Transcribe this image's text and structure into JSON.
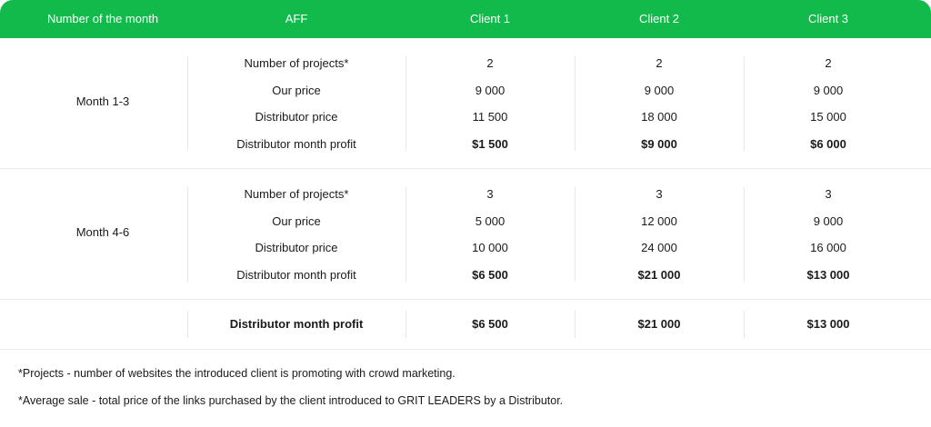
{
  "header": {
    "col_month": "Number of the month",
    "col_aff": "AFF",
    "col_client1": "Client 1",
    "col_client2": "Client 2",
    "col_client3": "Client 3"
  },
  "groups": [
    {
      "month": "Month 1-3",
      "rows": [
        {
          "label": "Number of projects*",
          "c1": "2",
          "c2": "2",
          "c3": "2"
        },
        {
          "label": "Our price",
          "c1": "9 000",
          "c2": "9 000",
          "c3": "9 000"
        },
        {
          "label": "Distributor price",
          "c1": "11 500",
          "c2": "18 000",
          "c3": "15 000"
        },
        {
          "label": "Distributor month profit",
          "c1": "$1 500",
          "c2": "$9 000",
          "c3": "$6 000"
        }
      ]
    },
    {
      "month": "Month 4-6",
      "rows": [
        {
          "label": "Number of projects*",
          "c1": "3",
          "c2": "3",
          "c3": "3"
        },
        {
          "label": "Our price",
          "c1": "5 000",
          "c2": "12 000",
          "c3": "9 000"
        },
        {
          "label": "Distributor price",
          "c1": "10 000",
          "c2": "24 000",
          "c3": "16 000"
        },
        {
          "label": "Distributor month profit",
          "c1": "$6 500",
          "c2": "$21 000",
          "c3": "$13 000"
        }
      ]
    }
  ],
  "total": {
    "label": "Distributor month profit",
    "c1": "$6 500",
    "c2": "$21 000",
    "c3": "$13 000"
  },
  "notes": [
    "*Projects - number of websites the introduced client is promoting with crowd marketing.",
    "*Average sale - total price of the links purchased by the client introduced to GRIT LEADERS by a Distributor."
  ]
}
